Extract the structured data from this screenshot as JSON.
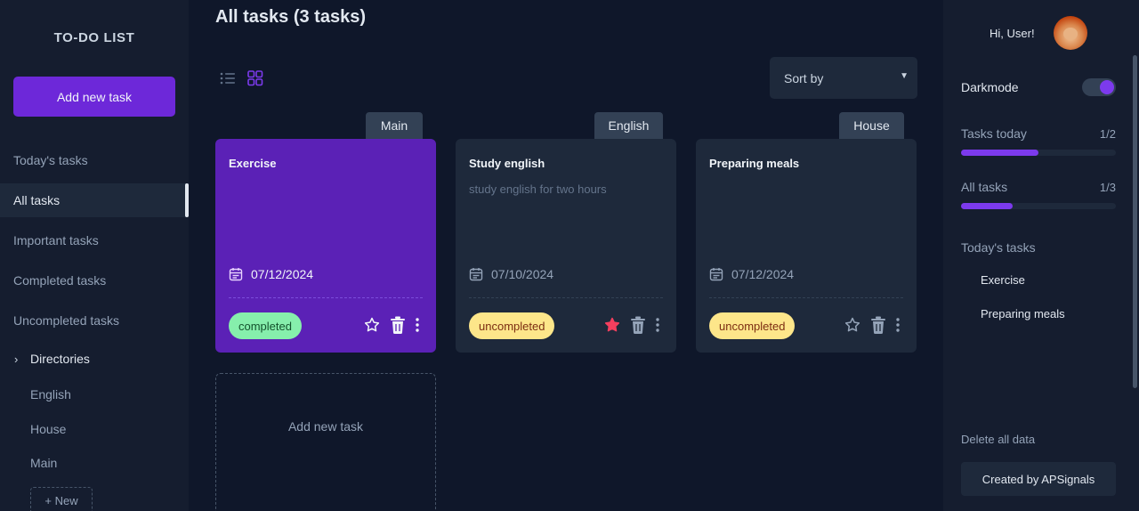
{
  "app": {
    "title": "TO-DO LIST"
  },
  "sidebar": {
    "add_button": "Add new task",
    "nav": [
      "Today's tasks",
      "All tasks",
      "Important tasks",
      "Completed tasks",
      "Uncompleted tasks"
    ],
    "active_nav": "All tasks",
    "directories_label": "Directories",
    "directories": [
      "English",
      "House",
      "Main"
    ],
    "new_dir": "+ New"
  },
  "main": {
    "title": "All tasks (3 tasks)",
    "sort_label": "Sort by",
    "view_mode": "grid",
    "cards": [
      {
        "tag": "Main",
        "title": "Exercise",
        "description": "",
        "date": "07/12/2024",
        "status": "completed",
        "important": false,
        "highlight": true
      },
      {
        "tag": "English",
        "title": "Study english",
        "description": "study english for two hours",
        "date": "07/10/2024",
        "status": "uncompleted",
        "important": true,
        "highlight": false
      },
      {
        "tag": "House",
        "title": "Preparing meals",
        "description": "",
        "date": "07/12/2024",
        "status": "uncompleted",
        "important": false,
        "highlight": false
      }
    ],
    "add_card": "Add new task"
  },
  "rpanel": {
    "greeting": "Hi, User!",
    "darkmode_label": "Darkmode",
    "darkmode_on": true,
    "tasks_today_label": "Tasks today",
    "tasks_today_count": "1/2",
    "tasks_today_progress": 0.5,
    "all_tasks_label": "All tasks",
    "all_tasks_count": "1/3",
    "all_tasks_progress": 0.333,
    "todays_tasks_heading": "Today's tasks",
    "todays_tasks": [
      "Exercise",
      "Preparing meals"
    ],
    "delete_all": "Delete all data",
    "created_by": "Created by APSignals"
  },
  "colors": {
    "accent": "#6d28d9",
    "background": "#0f172a",
    "panel": "#151d2f",
    "card": "#1e293b",
    "completed_badge": "#86efac",
    "uncompleted_badge": "#fde68a",
    "star_active": "#f43f5e"
  }
}
